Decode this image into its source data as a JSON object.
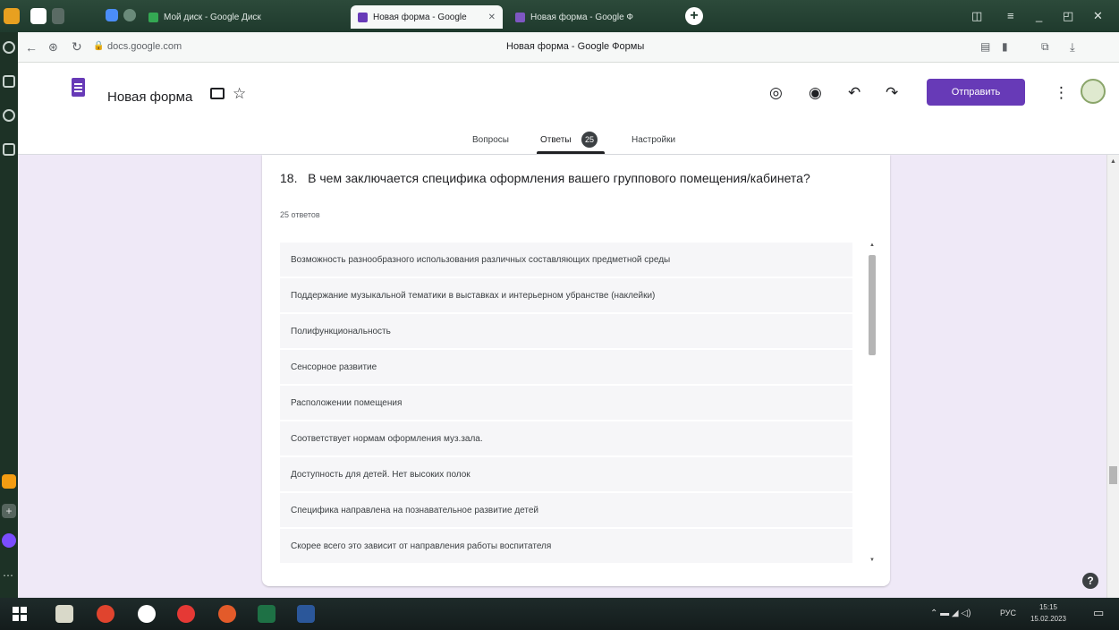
{
  "browser": {
    "tabs": [
      {
        "label": "Мой диск - Google Диск"
      },
      {
        "label": "Новая форма - Google"
      },
      {
        "label": "Новая форма - Google Ф"
      }
    ],
    "address": "docs.google.com",
    "page_title": "Новая форма - Google Формы"
  },
  "form": {
    "title": "Новая форма",
    "send_label": "Отправить",
    "tabs": {
      "questions": "Вопросы",
      "responses": "Ответы",
      "responses_badge": "25",
      "settings": "Настройки"
    }
  },
  "question": {
    "number": "18.",
    "text": "В чем заключается специфика оформления вашего группового помещения/кабинета?",
    "count": "25 ответов",
    "answers": [
      "Возможность разнообразного использования различных составляющих предметной среды",
      "Поддержание музыкальной тематики в выставках и интерьерном убранстве (наклейки)",
      "Полифункциональность",
      "Сенсорное развитие",
      "Расположении помещения",
      "Соответствует нормам оформления муз.зала.",
      "Доступность для детей. Нет высоких полок",
      "Специфика направлена на познавательное развитие детей",
      "Скорее всего это зависит от направления работы воспитателя"
    ]
  },
  "taskbar": {
    "lang": "РУС",
    "time": "15:15",
    "date": "15.02.2023"
  },
  "colors": {
    "accent": "#673ab7",
    "tab_underline": "#202124"
  },
  "icons": [
    "palette-icon",
    "eye-icon",
    "undo-icon",
    "redo-icon",
    "more-vert-icon",
    "avatar",
    "folder-icon",
    "star-icon",
    "help-icon"
  ]
}
